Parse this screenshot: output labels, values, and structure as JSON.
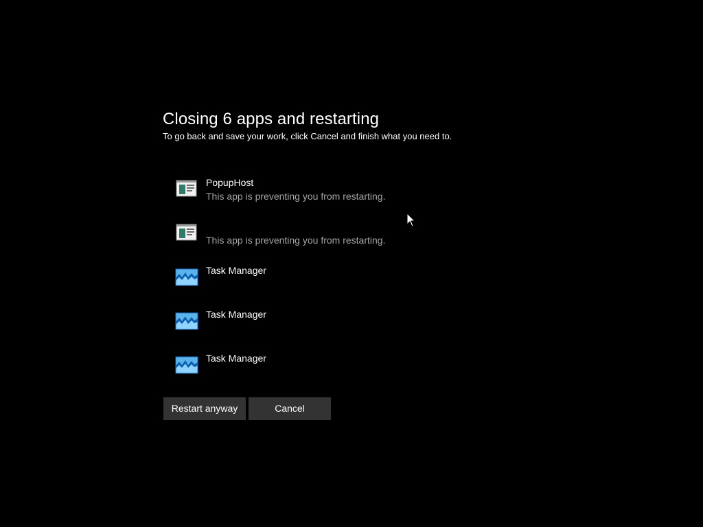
{
  "dialog": {
    "title": "Closing 6 apps and restarting",
    "subtitle": "To go back and save your work, click Cancel and finish what you need to."
  },
  "apps": [
    {
      "name": "PopupHost",
      "status": "This app is preventing you from restarting.",
      "icon": "popuphost-app-icon"
    },
    {
      "name": "",
      "status": "This app is preventing you from restarting.",
      "icon": "popuphost-app-icon"
    },
    {
      "name": "Task Manager",
      "status": "",
      "icon": "task-manager-icon"
    },
    {
      "name": "Task Manager",
      "status": "",
      "icon": "task-manager-icon"
    },
    {
      "name": "Task Manager",
      "status": "",
      "icon": "task-manager-icon"
    }
  ],
  "buttons": {
    "restart_label": "Restart anyway",
    "cancel_label": "Cancel"
  },
  "colors": {
    "background": "#000000",
    "button_bg": "#333333",
    "secondary_text": "#a6a6a6"
  }
}
